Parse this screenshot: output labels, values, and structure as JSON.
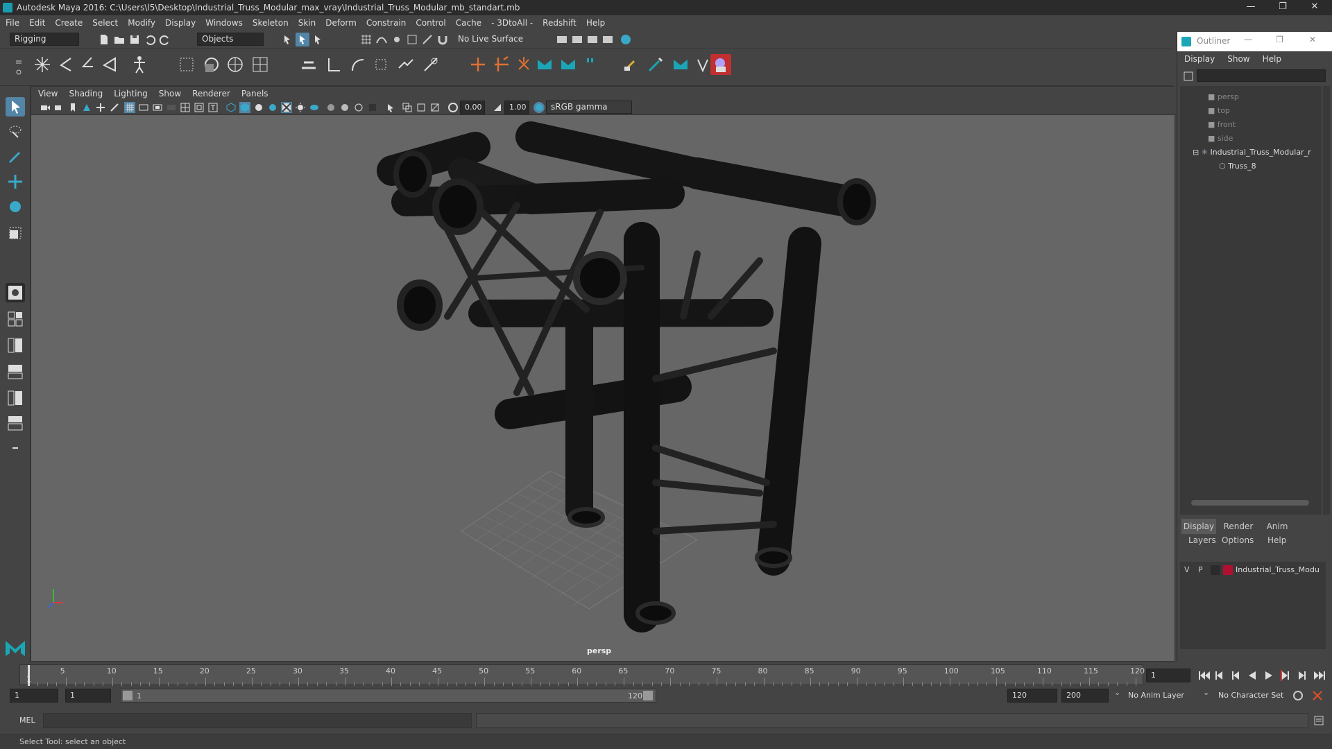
{
  "window": {
    "title": "Autodesk Maya 2016: C:\\Users\\l5\\Desktop\\Industrial_Truss_Modular_max_vray\\Industrial_Truss_Modular_mb_standart.mb",
    "minimize": "—",
    "restore": "❐",
    "close": "✕"
  },
  "menubar": [
    "File",
    "Edit",
    "Create",
    "Select",
    "Modify",
    "Display",
    "Windows",
    "Skeleton",
    "Skin",
    "Deform",
    "Constrain",
    "Control",
    "Cache",
    "- 3DtoAll -",
    "Redshift",
    "Help"
  ],
  "statusline": {
    "mode": "Rigging",
    "selection_mode": "Objects",
    "live_surface": "No Live Surface"
  },
  "viewport": {
    "menu": [
      "View",
      "Shading",
      "Lighting",
      "Show",
      "Renderer",
      "Panels"
    ],
    "exposure": "0.00",
    "gamma": "1.00",
    "colorspace": "sRGB gamma",
    "camera_label": "persp"
  },
  "outliner": {
    "title": "Outliner",
    "menu": [
      "Display",
      "Show",
      "Help"
    ],
    "items": [
      {
        "label": "persp",
        "type": "camera"
      },
      {
        "label": "top",
        "type": "camera"
      },
      {
        "label": "front",
        "type": "camera"
      },
      {
        "label": "side",
        "type": "camera"
      },
      {
        "label": "Industrial_Truss_Modular_r",
        "type": "group"
      },
      {
        "label": "Truss_8",
        "type": "mesh"
      }
    ]
  },
  "layer_editor": {
    "tabs": [
      "Display",
      "Render",
      "Anim"
    ],
    "menu": [
      "Layers",
      "Options",
      "Help"
    ],
    "layer": {
      "v": "V",
      "p": "P",
      "name": "Industrial_Truss_Modu",
      "color": "#b01030"
    }
  },
  "timeline": {
    "ticks": [
      "5",
      "10",
      "15",
      "20",
      "25",
      "30",
      "35",
      "40",
      "45",
      "50",
      "55",
      "60",
      "65",
      "70",
      "75",
      "80",
      "85",
      "90",
      "95",
      "100",
      "105",
      "110",
      "115",
      "120"
    ],
    "start_tick": "1",
    "current_frame": "1"
  },
  "range": {
    "start": "1",
    "anim_start": "1",
    "slider_start": "1",
    "slider_end": "120",
    "end": "120",
    "anim_end": "200",
    "anim_layer": "No Anim Layer",
    "character_set": "No Character Set"
  },
  "cmdline": {
    "label": "MEL"
  },
  "helpline": {
    "text": "Select Tool: select an object"
  }
}
